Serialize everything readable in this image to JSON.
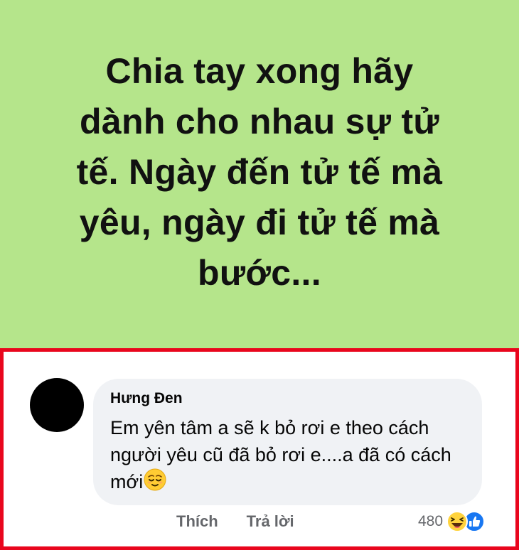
{
  "post": {
    "text": "Chia tay xong hãy\ndành cho nhau sự tử\ntế. Ngày đến tử tế mà\nyêu, ngày đi tử tế mà\nbước...",
    "background_color": "#b5e58b"
  },
  "comment": {
    "author": "Hưng Đen",
    "text": "Em yên tâm a sẽ k bỏ rơi e theo cách người yêu cũ đã bỏ rơi e....a đã có cách mới",
    "emoji_icon": "relieved-face-icon",
    "highlight_color": "#e9061d"
  },
  "actions": {
    "like_label": "Thích",
    "reply_label": "Trả lời"
  },
  "reactions": {
    "count": "480",
    "icons": [
      "haha-reaction-icon",
      "like-reaction-icon"
    ]
  }
}
